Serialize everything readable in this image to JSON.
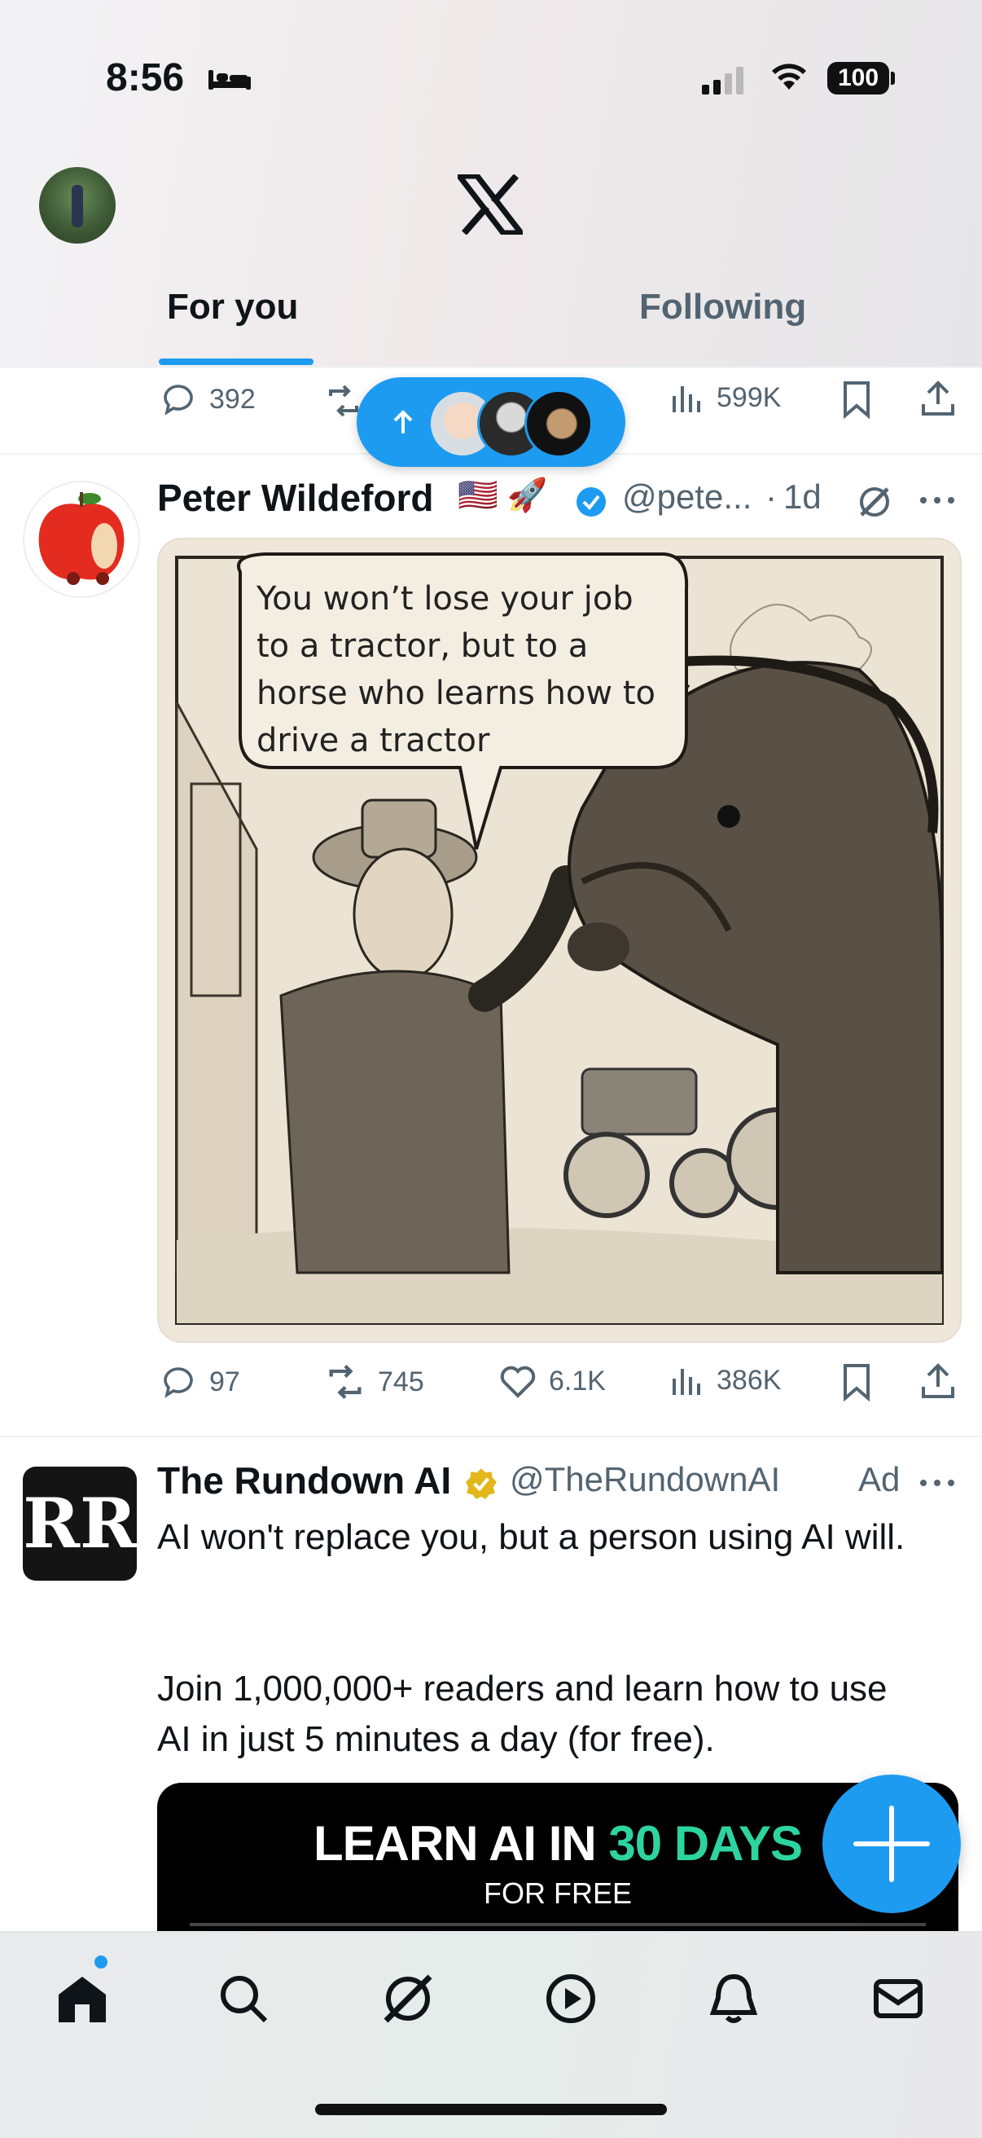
{
  "status_bar": {
    "time": "8:56",
    "battery": "100"
  },
  "header": {
    "logo_icon": "x-logo-icon",
    "tabs": [
      {
        "label": "For you",
        "active": true
      },
      {
        "label": "Following",
        "active": false
      }
    ]
  },
  "prev_tweet_actions": {
    "replies": "392",
    "views": "599K"
  },
  "new_posts_pill": {
    "icon": "arrow-up-icon"
  },
  "tweet": {
    "author_name": "Peter Wildeford",
    "emoji": "🇺🇸 🚀",
    "handle": "@pete...",
    "separator": "·",
    "time": "1d",
    "image_caption": "You won’t lose your job to a tractor, but to a horse who learns how to drive a tractor",
    "replies": "97",
    "reposts": "745",
    "likes": "6.1K",
    "views": "386K"
  },
  "ad": {
    "author_name": "The Rundown AI",
    "handle": "@TheRundownAI",
    "ad_label": "Ad",
    "avatar_text": "RR",
    "text_line1": "AI won't replace you, but a person using AI will.",
    "text_line2": "Join 1,000,000+ readers and learn how to use AI in just 5 minutes a day (for free).",
    "banner_title_part1": "LEARN AI IN ",
    "banner_title_part2": "30 DAYS",
    "banner_subtitle": "FOR FREE"
  },
  "colors": {
    "accent": "#1d9bf0",
    "text_primary": "#0f1419",
    "text_secondary": "#536471",
    "verified_gold": "#e2b719",
    "banner_green": "#2dd4a0"
  },
  "bottom_nav": [
    {
      "icon": "home-icon"
    },
    {
      "icon": "search-icon"
    },
    {
      "icon": "grok-icon"
    },
    {
      "icon": "video-icon"
    },
    {
      "icon": "notifications-icon"
    },
    {
      "icon": "messages-icon"
    }
  ]
}
